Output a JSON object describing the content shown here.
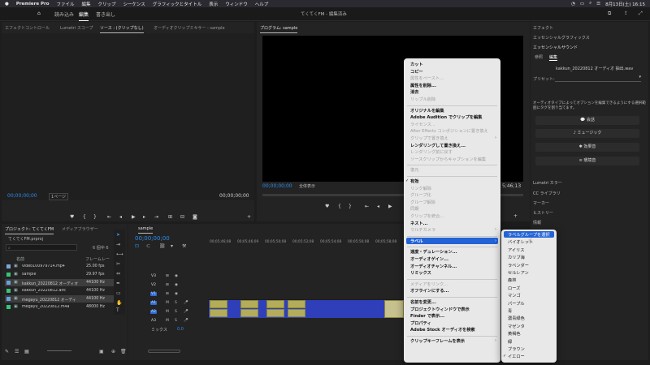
{
  "menubar": {
    "app": "Premiere Pro",
    "items": [
      "ファイル",
      "編集",
      "クリップ",
      "シーケンス",
      "グラフィックとタイトル",
      "表示",
      "ウィンドウ",
      "ヘルプ"
    ],
    "clock": "8月13日(土) 16:15"
  },
  "header": {
    "tabs": [
      "読み込み",
      "編集",
      "書き出し"
    ],
    "project_title": "てくてくFM - 編集済み"
  },
  "source_panel": {
    "tabs": [
      "エフェクトコントロール",
      "Lumetri スコープ",
      "ソース : (クリップなし)",
      "オーディオクリップミキサー : sample"
    ],
    "timecode_left": "00;00;00;00",
    "page": "1ページ",
    "timecode_right": "00;00;00;00"
  },
  "program_panel": {
    "title": "プログラム: sample",
    "timecode": "00;00;00;00",
    "zoom": "全体表示",
    "timecode_right": "5;46;13"
  },
  "project_panel": {
    "tabs": [
      "プロジェクト: てくてくFM",
      "メディアブラウザー"
    ],
    "file": "てくてくFM.prproj",
    "count": "6 個中 6",
    "col_name": "名前",
    "col_rate": "フレームレー",
    "rows": [
      {
        "name": "video100979714.mp4",
        "rate": "25.00 fps",
        "color": "#7aa7d9"
      },
      {
        "name": "sample",
        "rate": "29.97 fps",
        "color": "#36c47a"
      },
      {
        "name": "kakkun_20220812 オーディオ",
        "rate": "44100 Hz",
        "color": "#6aa0e0"
      },
      {
        "name": "kakkun_20220812.aifc",
        "rate": "44100 Hz",
        "color": "#36c47a"
      },
      {
        "name": "megayu_20220812 オーディ",
        "rate": "44100 Hz",
        "color": "#6aa0e0"
      },
      {
        "name": "megayu_20220812.m4a",
        "rate": "48000 Hz",
        "color": "#36c47a"
      }
    ]
  },
  "timeline": {
    "tab": "sample",
    "timecode": "00;00;00;00",
    "ruler": [
      "00;05;46;08",
      "00;05;46;09",
      "00;05;50;08",
      "00;05;52;08",
      "00;05;54;08",
      "00;05;56;08",
      "00;05;58;08"
    ],
    "tracks": [
      "V3",
      "V2",
      "V1",
      "A1",
      "A2",
      "A3"
    ],
    "mix_label": "ミックス",
    "mix_value": "0.0"
  },
  "context_menu": {
    "items": [
      {
        "label": "カット",
        "state": "enabled"
      },
      {
        "label": "コピー",
        "state": "enabled"
      },
      {
        "label": "属性をペースト...",
        "state": "disabled"
      },
      {
        "label": "属性を削除...",
        "state": "enabled"
      },
      {
        "label": "消去",
        "state": "enabled"
      },
      {
        "label": "リップル削除",
        "state": "disabled"
      },
      {
        "label": "オリジナルを編集",
        "state": "enabled"
      },
      {
        "label": "Adobe Audition でクリップを編集",
        "state": "enabled"
      },
      {
        "label": "ライセンス...",
        "state": "disabled"
      },
      {
        "label": "After Effects コンポジションに置き換え",
        "state": "disabled"
      },
      {
        "label": "クリップで置き換え",
        "state": "disabled"
      },
      {
        "label": "レンダリングして置き換え...",
        "state": "enabled"
      },
      {
        "label": "レンダリング前に戻す",
        "state": "disabled"
      },
      {
        "label": "ソースクリップからキャプションを編集",
        "state": "disabled"
      },
      {
        "label": "復元",
        "state": "disabled"
      },
      {
        "label": "有効",
        "state": "checked"
      },
      {
        "label": "リンク解除",
        "state": "disabled"
      },
      {
        "label": "グループ化",
        "state": "disabled"
      },
      {
        "label": "グループ解除",
        "state": "disabled"
      },
      {
        "label": "同期",
        "state": "disabled"
      },
      {
        "label": "クリップを統合...",
        "state": "disabled"
      },
      {
        "label": "ネスト...",
        "state": "enabled"
      },
      {
        "label": "マルチカメラ",
        "state": "disabled"
      },
      {
        "label": "ラベル",
        "state": "highlighted"
      },
      {
        "label": "速度・デュレーション...",
        "state": "enabled"
      },
      {
        "label": "オーディオゲイン...",
        "state": "enabled"
      },
      {
        "label": "オーディオチャンネル...",
        "state": "enabled"
      },
      {
        "label": "リミックス",
        "state": "enabled"
      },
      {
        "label": "メディアをリンク...",
        "state": "disabled"
      },
      {
        "label": "オフラインにする...",
        "state": "enabled"
      },
      {
        "label": "名前を変更...",
        "state": "enabled"
      },
      {
        "label": "プロジェクトウィンドウで表示",
        "state": "enabled"
      },
      {
        "label": "Finder で表示...",
        "state": "enabled"
      },
      {
        "label": "プロパティ",
        "state": "enabled"
      },
      {
        "label": "Adobe Stock オーディオを検索",
        "state": "enabled"
      },
      {
        "label": "クリップキーフレームを表示",
        "state": "enabled"
      }
    ]
  },
  "label_submenu": {
    "items": [
      "ラベルグループを選択",
      "バイオレット",
      "アイリス",
      "カリブ海",
      "ラベンダー",
      "セルレアン",
      "森林",
      "ローズ",
      "マンゴ",
      "パープル",
      "青",
      "濃青緑色",
      "マゼンタ",
      "黄褐色",
      "緑",
      "ブラウン",
      "イエロー"
    ],
    "checked": "イエロー"
  },
  "essential_sound": {
    "panel_tabs": [
      "エフェクト",
      "エッセンシャルグラフィックス",
      "エッセンシャルサウンド"
    ],
    "subtabs": [
      "参照",
      "編集"
    ],
    "clip": "kakkun_20220812 オーディオ 抽出.wav",
    "preset_label": "プリセット:",
    "description": "オーディオタイプによってオプションを編集できるようにする選択範囲にタグを割り当てます。",
    "buttons": [
      "会話",
      "ミュージック",
      "効果音",
      "環境音"
    ],
    "bottom_tabs": [
      "Lumetri カラー",
      "CC ライブラリ",
      "マーカー",
      "ヒストリー",
      "情報"
    ]
  }
}
